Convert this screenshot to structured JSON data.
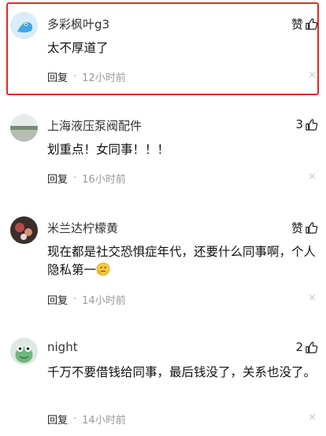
{
  "comments": [
    {
      "username": "多彩枫叶g3",
      "like_label": "赞",
      "like_count": "",
      "content": "太不厚道了",
      "reply_label": "回复",
      "separator": "·",
      "time": "12小时前",
      "close_glyph": "×"
    },
    {
      "username": "上海液压泵阀配件",
      "like_label": "",
      "like_count": "3",
      "content": "划重点！女同事！！！",
      "reply_label": "回复",
      "separator": "·",
      "time": "16小时前",
      "close_glyph": "×"
    },
    {
      "username": "米兰达柠檬黄",
      "like_label": "赞",
      "like_count": "",
      "content": "现在都是社交恐惧症年代，还要什么同事啊，个人隐私第一",
      "reply_label": "回复",
      "separator": "·",
      "time": "14小时前",
      "close_glyph": "×"
    },
    {
      "username": "night",
      "like_label": "",
      "like_count": "2",
      "content": "千万不要借钱给同事，最后钱没了，关系也没了。",
      "reply_label": "回复",
      "separator": "·",
      "time": "14小时前",
      "close_glyph": "×"
    }
  ],
  "colors": {
    "highlight": "#e02a2a",
    "meta_gray": "#999999",
    "text": "#111111"
  },
  "icons": {
    "like": "thumbs-up-icon",
    "close": "close-icon",
    "emoji": "thinking-emoji-icon"
  }
}
